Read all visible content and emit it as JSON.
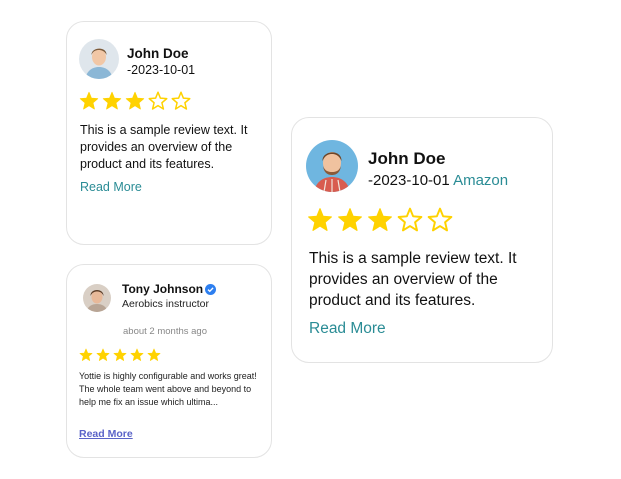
{
  "colors": {
    "star": "#FFD200",
    "accent": "#2a8c95",
    "link_blue": "#5a63c8",
    "badge": "#2d7ff0"
  },
  "card1": {
    "name": "John Doe",
    "date": "-2023-10-01",
    "rating": 3,
    "max_rating": 5,
    "text": "This is a sample review text. It provides an overview of the product and its features.",
    "read_more": "Read More"
  },
  "card2": {
    "name": "Tony Johnson",
    "verified_icon": "verified-badge-icon",
    "role": "Aerobics instructor",
    "time": "about 2 months ago",
    "rating": 5,
    "max_rating": 5,
    "text": "Yottie is highly configurable and works great! The whole team went above and beyond to help me fix an issue which ultima...",
    "read_more": "Read More"
  },
  "card3": {
    "name": "John Doe",
    "date": "-2023-10-01",
    "source": "Amazon",
    "rating": 3,
    "max_rating": 5,
    "text": "This is a sample review text. It provides an overview of the product and its features.",
    "read_more": "Read More"
  }
}
